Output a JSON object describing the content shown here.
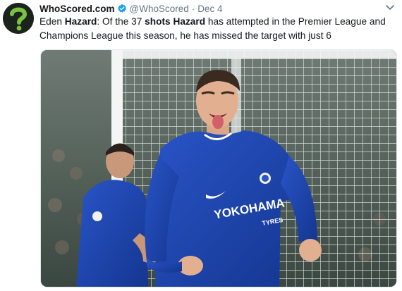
{
  "account": {
    "display_name": "WhoScored.com",
    "handle": "@WhoScored",
    "separator": "·",
    "date": "Dec 4",
    "avatar_icon": "whoscored-question-mark-logo",
    "verified_icon": "verified-badge-icon",
    "menu_icon": "chevron-down-icon"
  },
  "tweet": {
    "text_parts": [
      {
        "text": "Eden ",
        "bold": false
      },
      {
        "text": "Hazard",
        "bold": true
      },
      {
        "text": ": Of the 37 ",
        "bold": false
      },
      {
        "text": "shots",
        "bold": true
      },
      {
        "text": " ",
        "bold": false
      },
      {
        "text": "Hazard",
        "bold": true
      },
      {
        "text": " has attempted in the Premier League and Champions League this season, he has missed the target with just 6",
        "bold": false
      }
    ]
  },
  "media": {
    "type": "photo",
    "jersey_sponsor": "YOKOHAMA",
    "jersey_sponsor_sub": "TYRES"
  },
  "colors": {
    "accent": "#1da1f2",
    "text": "#14171a",
    "muted": "#657786",
    "logo_green": "#7ac143",
    "kit_blue": "#1b3fa0"
  }
}
